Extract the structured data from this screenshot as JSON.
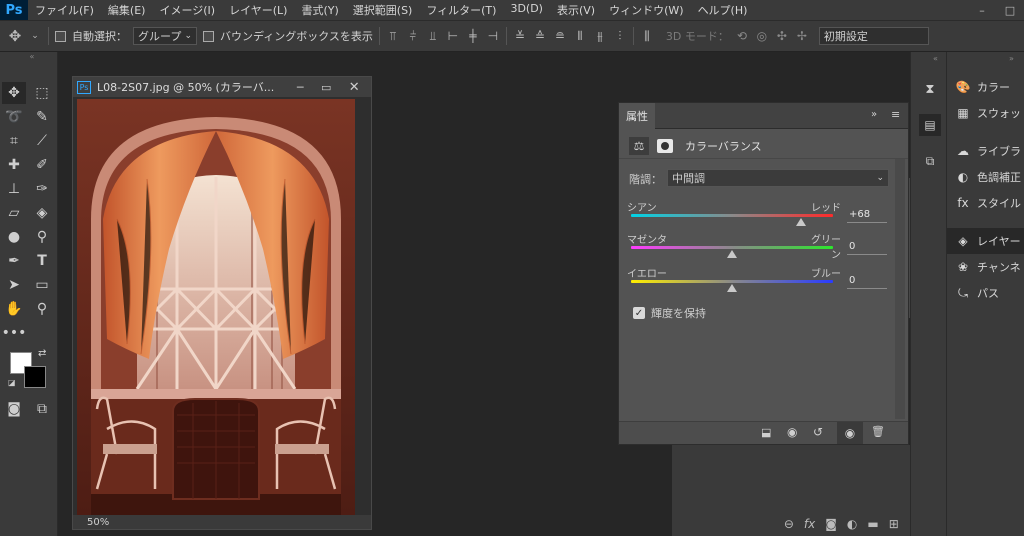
{
  "app": {
    "logo": "Ps"
  },
  "menu": [
    "ファイル(F)",
    "編集(E)",
    "イメージ(I)",
    "レイヤー(L)",
    "書式(Y)",
    "選択範囲(S)",
    "フィルター(T)",
    "3D(D)",
    "表示(V)",
    "ウィンドウ(W)",
    "ヘルプ(H)"
  ],
  "window_controls": {
    "minimize": "–",
    "maximize": "□"
  },
  "options": {
    "auto_select_label": "自動選択：",
    "auto_select_value": "グループ",
    "bbox_label": "バウンディングボックスを表示",
    "mode_3d_label": "3D モード：",
    "workspace_value": "初期設定"
  },
  "document": {
    "title": "L08-2S07.jpg @ 50% (カラーバ...",
    "zoom": "50%",
    "ps_badge": "Ps"
  },
  "properties": {
    "tab_label": "属性",
    "adjustment_name": "カラーバランス",
    "tone_label": "階調：",
    "tone_value": "中間調",
    "sliders": [
      {
        "left": "シアン",
        "right": "レッド",
        "value": "+68",
        "level": 68,
        "colors": [
          "#00d2e6",
          "#ff2a2a"
        ]
      },
      {
        "left": "マゼンタ",
        "right": "グリーン",
        "value": "0",
        "level": 0,
        "colors": [
          "#ff3cff",
          "#2ce62c"
        ]
      },
      {
        "left": "イエロー",
        "right": "ブルー",
        "value": "0",
        "level": 0,
        "colors": [
          "#ffee00",
          "#2a3cff"
        ]
      }
    ],
    "preserve_label": "輝度を保持",
    "preserve_checked": true
  },
  "dock": {
    "items": [
      {
        "label": "カラー",
        "icon": "palette-icon"
      },
      {
        "label": "スウォッ",
        "icon": "grid-icon"
      },
      {
        "label": "ライブラ",
        "icon": "cloud-icon"
      },
      {
        "label": "色調補正",
        "icon": "contrast-icon"
      },
      {
        "label": "スタイル",
        "icon": "fx-icon"
      },
      {
        "label": "レイヤー",
        "icon": "layers-icon"
      },
      {
        "label": "チャンネ",
        "icon": "channels-icon"
      },
      {
        "label": "パス",
        "icon": "path-icon"
      }
    ]
  },
  "partial_panel": {
    "percent_1": "%",
    "percent_2": "%"
  }
}
